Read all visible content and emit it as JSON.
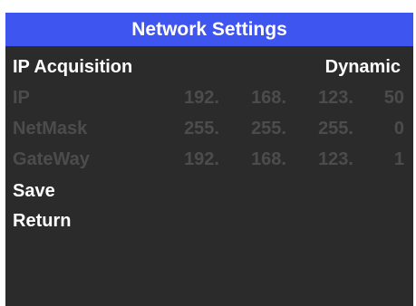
{
  "header": {
    "title": "Network Settings"
  },
  "ip_acquisition": {
    "label": "IP Acquisition",
    "value": "Dynamic"
  },
  "fields": [
    {
      "label": "IP",
      "octets": [
        "192.",
        "168.",
        "123.",
        "50"
      ]
    },
    {
      "label": "NetMask",
      "octets": [
        "255.",
        "255.",
        "255.",
        "0"
      ]
    },
    {
      "label": "GateWay",
      "octets": [
        "192.",
        "168.",
        "123.",
        "1"
      ]
    }
  ],
  "menu": {
    "save_label": "Save",
    "return_label": "Return"
  },
  "colors": {
    "title_bar": "#3f55f0",
    "background": "#2b2b2b",
    "active_text": "#ffffff",
    "disabled_text": "#4c4c4c"
  }
}
